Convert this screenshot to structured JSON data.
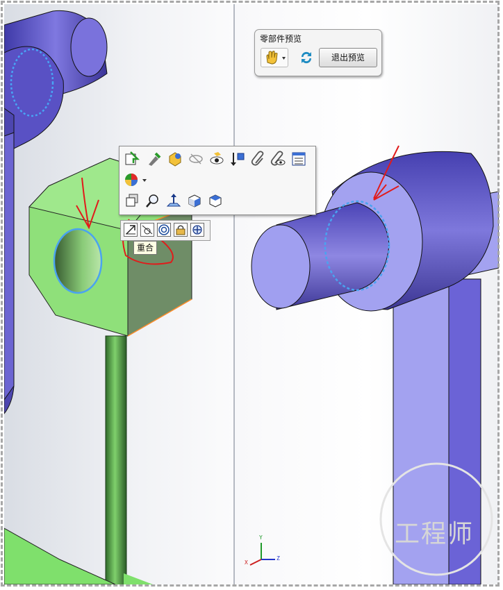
{
  "preview_panel": {
    "title": "零部件预览",
    "exit_button": "退出预览",
    "hand_icon": "hand-select-icon",
    "refresh_icon": "refresh-icon"
  },
  "context_toolbar": {
    "row1_icons": [
      "open-part-icon",
      "edit-component-icon",
      "appearance-icon",
      "hide-icon",
      "isolate-icon",
      "move-component-icon",
      "paperclip-icon",
      "show-hide-mates-icon",
      "properties-list-icon"
    ],
    "row2_icons": [
      "color-wheel-icon"
    ],
    "row3_icons": [
      "select-component-icon",
      "zoom-to-selection-icon",
      "normal-to-icon",
      "view-cube-icon",
      "display-style-icon"
    ]
  },
  "mate_bar": {
    "icons": [
      "coincident-icon",
      "tangent-icon",
      "concentric-icon",
      "lock-icon",
      "center-icon"
    ],
    "tooltip": "重合"
  },
  "axes": {
    "x": "X",
    "y": "Y",
    "z": "Z"
  },
  "watermark": {
    "text": "工程师"
  },
  "colors": {
    "left_part": "#8fe07a",
    "left_part_dark": "#6e8e66",
    "purple_part": "#6b63d6",
    "purple_light": "#a8a7f0",
    "selection_blue": "#4aa3f0",
    "annotation_red": "#e11b1b"
  }
}
